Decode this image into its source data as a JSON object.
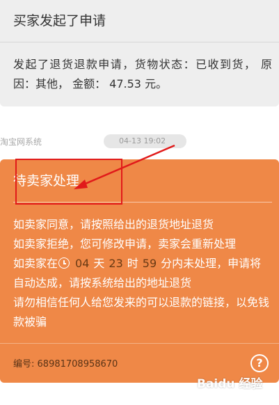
{
  "card1": {
    "title": "买家发起了申请",
    "body": "发起了退货退款申请，货物状态：已收到货， 原因：其他， 金额： 47.53 元。"
  },
  "chat": {
    "sender": "淘宝网系统",
    "time": "04-13 19:02"
  },
  "card2": {
    "title": "待卖家处理",
    "line1": "如卖家同意，请按照给出的退货地址退货",
    "line2": "如卖家拒绝，您可修改申请，卖家会重新处理",
    "line3_prefix": "如卖家在",
    "countdown": {
      "days": "04",
      "days_unit": "天",
      "hours": "23",
      "hours_unit": "时",
      "minutes": "59",
      "minutes_unit": "分",
      "suffix": "内未处理，申请将"
    },
    "line4": "自动达成，请按系统给出的地址退货",
    "line5": "请勿相信任何人给您发来的可以退款的链接，以免钱款被骗",
    "order_label": "编号:",
    "order_number": "68981708958670",
    "help_symbol": "?"
  },
  "watermark": "Baidu 经验",
  "colors": {
    "card1_bg": "#eeeeee",
    "card2_bg": "#ef8847",
    "annotation": "#e11a1a"
  },
  "icons": [
    "clock-icon",
    "help-icon",
    "arrow-annotation"
  ]
}
